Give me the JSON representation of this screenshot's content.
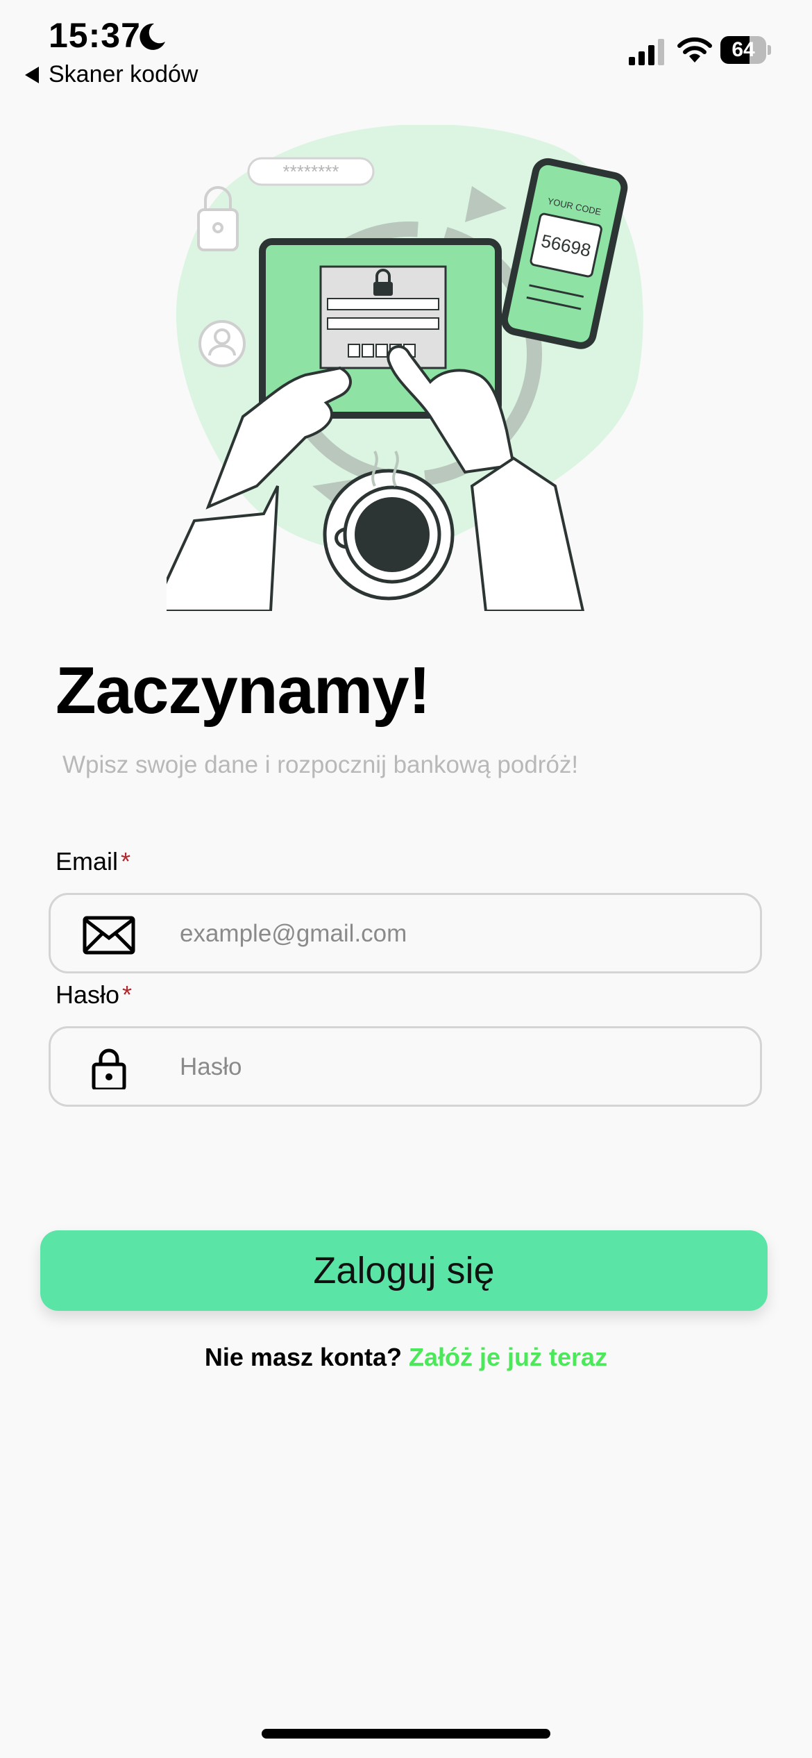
{
  "status_bar": {
    "time": "15:37",
    "back_label": "Skaner kodów",
    "battery": "64",
    "battery_level": 0.64
  },
  "illustration": {
    "password_stars": "********",
    "phone_caption": "YOUR CODE",
    "phone_code": "56698"
  },
  "header": {
    "title": "Zaczynamy!",
    "subtitle": "Wpisz swoje dane i rozpocznij bankową podróż!"
  },
  "form": {
    "email_label": "Email",
    "email_required": "*",
    "email_placeholder": "example@gmail.com",
    "email_value": "",
    "password_label": "Hasło",
    "password_required": "*",
    "password_placeholder": "Hasło",
    "password_value": ""
  },
  "login_button": "Zaloguj się",
  "signup": {
    "prompt": "Nie masz konta?",
    "link": "Załóż je już teraz"
  },
  "colors": {
    "accent": "#5ae4a6",
    "link": "#4be85a",
    "required": "#b3262c",
    "illustration_green": "#8ee3a4",
    "illustration_bg": "#dcf5e2"
  }
}
